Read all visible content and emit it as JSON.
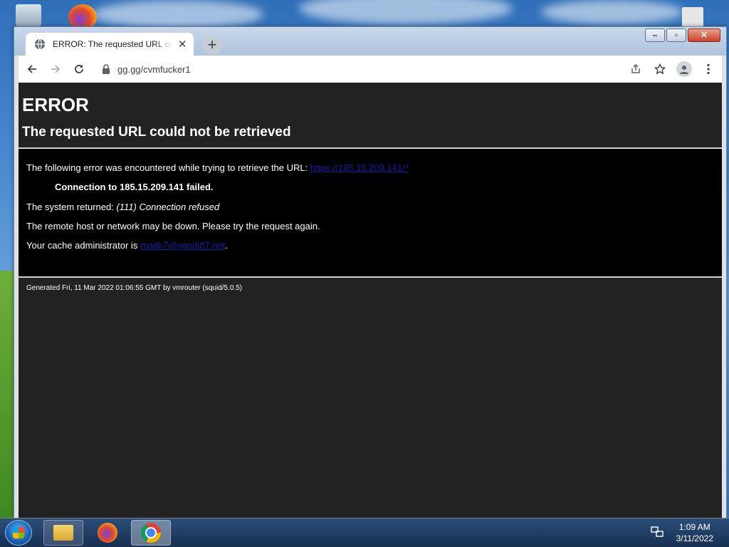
{
  "browser": {
    "tab": {
      "title": "ERROR: The requested URL could not be retrieved"
    },
    "url": "gg.gg/cvmfucker1"
  },
  "page": {
    "heading": "ERROR",
    "subheading": "The requested URL could not be retrieved",
    "error_intro": "The following error was encountered while trying to retrieve the URL: ",
    "error_url": "https://185.15.209.141/*",
    "connection_failed": "Connection to 185.15.209.141 failed.",
    "system_returned_label": "The system returned: ",
    "system_returned_value": "(111) Connection refused",
    "remote_down": "The remote host or network may be down. Please try the request again.",
    "cache_admin_label": "Your cache administrator is ",
    "cache_admin_email": "madk7@gasdi87.net",
    "cache_admin_suffix": ".",
    "footer": "Generated Fri, 11 Mar 2022 01:06:55 GMT by vmrouter (squid/5.0.5)"
  },
  "taskbar": {
    "time": "1:09 AM",
    "date": "3/11/2022"
  },
  "icons": {
    "tab_favicon": "globe-icon",
    "tab_close": "close-icon",
    "new_tab": "plus-icon",
    "back": "arrow-left-icon",
    "forward": "arrow-right-icon",
    "reload": "reload-icon",
    "lock": "lock-icon",
    "share": "share-icon",
    "bookmark": "star-icon",
    "profile": "person-icon",
    "menu": "kebab-menu-icon"
  },
  "colors": {
    "page_background": "#222222",
    "error_box_background": "#000000",
    "link": "#1a1aa6"
  }
}
